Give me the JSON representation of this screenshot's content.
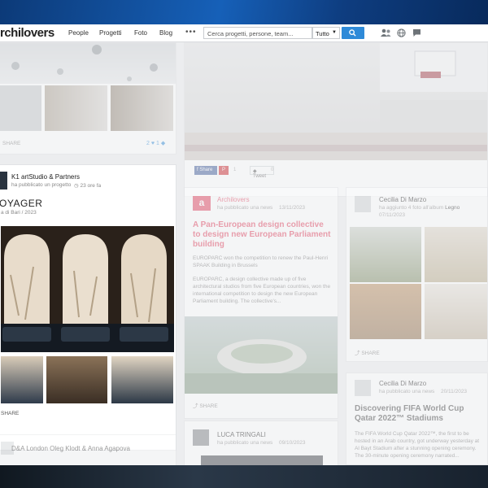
{
  "header": {
    "logo": "rchilovers",
    "nav": [
      "People",
      "Progetti",
      "Foto",
      "Blog"
    ],
    "more": "•••",
    "search_placeholder": "Cerca progetti, persone, team...",
    "filter_value": "Tutto"
  },
  "left_top": {
    "likes": "2",
    "tags": "1",
    "share": "SHARE"
  },
  "k1": {
    "author": "K1 artStudio & Partners",
    "action": "ha pubblicato un progetto",
    "time": "23 ore fa",
    "title": "OYAGER",
    "subtitle": "a di Bari / 2023",
    "share": "SHARE"
  },
  "left_bottom": {
    "author": "D&A London Oleg Klodt & Anna Agapova"
  },
  "social": {
    "fb": "Share",
    "tweet": "Tweet",
    "count_a": "1",
    "count_b": "0"
  },
  "europarc": {
    "author": "Archilovers",
    "action": "ha pubblicato una news",
    "date": "13/11/2023",
    "title": "A Pan-European design collective to design new European Parliament building",
    "sub": "EUROPARC won the competition to renew the Paul-Henri SPAAK Building in Brussels",
    "body": "EUROPARC, a design collective made up of five architectural studios from five European countries, won the international competition to design the new European Parliament building. The collective's...",
    "share": "SHARE"
  },
  "luca": {
    "author": "LUCA TRINGALI",
    "action": "ha pubblicato una news",
    "date": "09/10/2023"
  },
  "cecilia1": {
    "author": "Cecilia Di Marzo",
    "action": "ha aggiunto 4 foto all'album",
    "album": "Legno",
    "date": "07/11/2023",
    "share": "SHARE"
  },
  "cecilia2": {
    "author": "Cecilia Di Marzo",
    "action": "ha pubblicato una news",
    "date": "20/11/2023",
    "title": "Discovering FIFA World Cup Qatar 2022™ Stadiums",
    "body": "The FIFA World Cup Qatar 2022™, the first to be hosted in an Arab country, got underway yesterday at Al Bayt Stadium after a stunning opening ceremony. The 30-minute opening ceremony narrated..."
  },
  "colors": {
    "accent": "#e33d5a",
    "primary": "#2e8ad8"
  }
}
